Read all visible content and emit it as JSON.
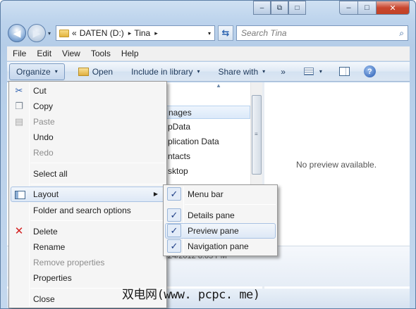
{
  "window": {
    "caption_buttons": {
      "minimize": "–",
      "maximize": "□",
      "close": "✕"
    },
    "secondary_buttons": [
      "–",
      "⧉",
      "□"
    ]
  },
  "nav": {
    "back_glyph": "◀",
    "forward_glyph": "▶",
    "history_glyph": "▾",
    "breadcrumb_prefix": "«",
    "breadcrumb": [
      "DATEN (D:)",
      "Tina"
    ],
    "crumb_sep": "▸",
    "dropdown_glyph": "▾",
    "refresh_glyph": "⇆",
    "search_placeholder": "Search Tina",
    "search_icon": "magnifier-icon"
  },
  "menubar": [
    "File",
    "Edit",
    "View",
    "Tools",
    "Help"
  ],
  "toolbar": {
    "organize": "Organize",
    "open": "Open",
    "include": "Include in library",
    "share": "Share with",
    "more": "»",
    "help": "?",
    "dd": "▾"
  },
  "files": {
    "sort_glyph": "▲",
    "items": [
      "nages",
      "pData",
      "plication Data",
      "ntacts",
      "sktop",
      ""
    ],
    "selected_index": 0,
    "date_modified": "24/2012 8:05 PM"
  },
  "preview": {
    "text": "No preview available."
  },
  "organize_menu": {
    "items": [
      {
        "label": "Cut",
        "icon": "scissors-icon",
        "glyph": "✂",
        "disabled": false
      },
      {
        "label": "Copy",
        "icon": "copy-icon",
        "glyph": "❐",
        "disabled": false
      },
      {
        "label": "Paste",
        "icon": "paste-icon",
        "glyph": "▤",
        "disabled": true
      },
      {
        "label": "Undo",
        "disabled": false
      },
      {
        "label": "Redo",
        "disabled": true
      },
      {
        "label": "Select all",
        "disabled": false
      },
      {
        "label": "Layout",
        "icon": "layout-icon",
        "has_submenu": true
      },
      {
        "label": "Folder and search options",
        "disabled": false
      },
      {
        "label": "Delete",
        "icon": "delete-icon",
        "glyph": "✕",
        "disabled": false
      },
      {
        "label": "Rename",
        "disabled": false
      },
      {
        "label": "Remove properties",
        "disabled": true
      },
      {
        "label": "Properties",
        "disabled": false
      },
      {
        "label": "Close",
        "disabled": false
      }
    ],
    "submenu_arrow": "▶"
  },
  "layout_submenu": {
    "check_glyph": "✓",
    "items": [
      {
        "label": "Menu bar",
        "checked": true
      },
      {
        "label": "Details pane",
        "checked": true
      },
      {
        "label": "Preview pane",
        "checked": true,
        "highlighted": true
      },
      {
        "label": "Navigation pane",
        "checked": true
      }
    ]
  },
  "watermark": "双电网(www. pcpc. me)",
  "colors": {
    "accent": "#1f3f86",
    "delete_red": "#d32020",
    "scissors_blue": "#2a5dae"
  }
}
